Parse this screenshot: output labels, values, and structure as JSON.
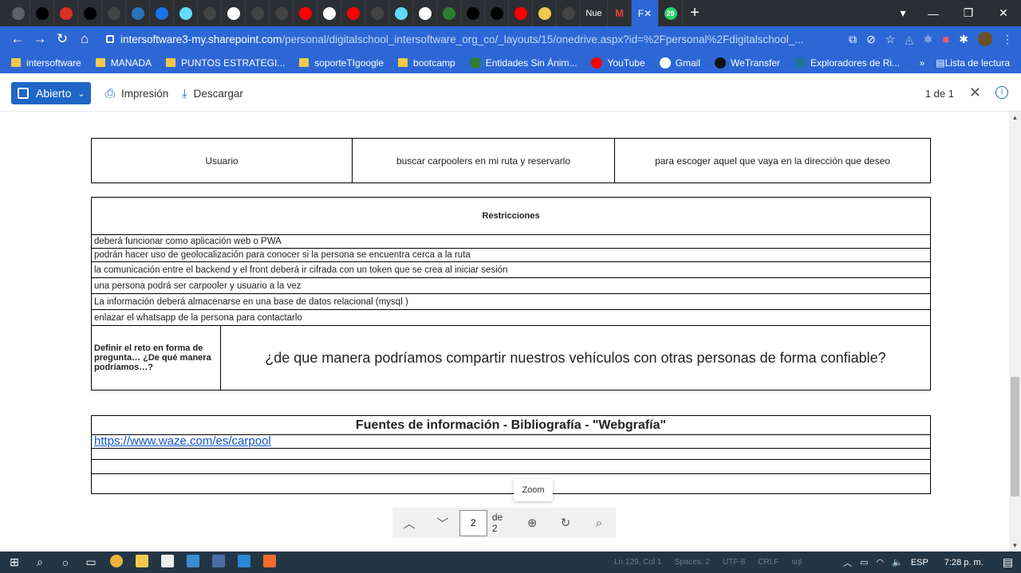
{
  "browser": {
    "tabs": [
      {
        "icon": "chrome-icon",
        "color": "#5f6368"
      },
      {
        "icon": "bowtie-icon",
        "color": "#000000"
      },
      {
        "icon": "red-hex-icon",
        "color": "#d93025"
      },
      {
        "icon": "bowtie-icon",
        "color": "#000000"
      },
      {
        "icon": "github-icon",
        "color": "#444444"
      },
      {
        "icon": "js-icon",
        "color": "#2a73b8"
      },
      {
        "icon": "sync-icon",
        "color": "#1a73e8"
      },
      {
        "icon": "react-icon",
        "color": "#61dafb"
      },
      {
        "icon": "github-icon",
        "color": "#444444"
      },
      {
        "icon": "google-icon",
        "color": "#ffffff"
      },
      {
        "icon": "github-icon",
        "color": "#444444"
      },
      {
        "icon": "github-icon",
        "color": "#444444"
      },
      {
        "icon": "youtube-icon",
        "color": "#ff0000"
      },
      {
        "icon": "play-icon",
        "color": "#ffffff"
      },
      {
        "icon": "youtube-icon",
        "color": "#ff0000"
      },
      {
        "icon": "github-icon",
        "color": "#444444"
      },
      {
        "icon": "react-icon",
        "color": "#61dafb"
      },
      {
        "icon": "google-icon",
        "color": "#ffffff"
      },
      {
        "icon": "green-circle-icon",
        "color": "#2e7d32"
      },
      {
        "icon": "medium-icon",
        "color": "#000000"
      },
      {
        "icon": "bowtie-icon",
        "color": "#000000"
      },
      {
        "icon": "youtube-icon",
        "color": "#ff0000"
      },
      {
        "icon": "braces-icon",
        "color": "#f2c94c"
      },
      {
        "icon": "github-icon",
        "color": "#444444"
      }
    ],
    "tab_text": "Nue",
    "gmail_tab": "M",
    "active_tab": "F",
    "whatsapp_badge": "29",
    "url_host": "intersoftware3-my.sharepoint.com",
    "url_path": "/personal/digitalschool_intersoftware_org_co/_layouts/15/onedrive.aspx?id=%2Fpersonal%2Fdigitalschool_..."
  },
  "bookmarks": {
    "items": [
      {
        "label": "intersoftware",
        "type": "folder"
      },
      {
        "label": "MANADA",
        "type": "folder"
      },
      {
        "label": "PUNTOS ESTRATEGI...",
        "type": "folder"
      },
      {
        "label": "soporteTIgoogle",
        "type": "folder"
      },
      {
        "label": "bootcamp",
        "type": "folder"
      },
      {
        "label": "Entidades Sin Ánim...",
        "type": "link",
        "icon": "tree-icon",
        "color": "#2e7d32"
      },
      {
        "label": "YouTube",
        "type": "link",
        "icon": "youtube-icon",
        "color": "#ff0000"
      },
      {
        "label": "Gmail",
        "type": "link",
        "icon": "google-icon",
        "color": "#ffffff"
      },
      {
        "label": "WeTransfer",
        "type": "link",
        "icon": "we-icon",
        "color": "#111111"
      },
      {
        "label": "Exploradores de Ri...",
        "type": "link",
        "icon": "wordpress-icon",
        "color": "#21759b"
      }
    ],
    "overflow": "»",
    "reading_list": "Lista de lectura"
  },
  "viewer": {
    "open_label": "Abierto",
    "print_label": "Impresión",
    "download_label": "Descargar",
    "page_count": "1 de 1"
  },
  "document": {
    "user_story": {
      "role": "Usuario",
      "action": "buscar carpoolers en mi ruta  y reservarlo",
      "purpose": "para escoger aquel que vaya en la dirección que deseo"
    },
    "restrictions": {
      "title": "Restricciones",
      "items": [
        "deberá funcionar como aplicación web o PWA",
        "podrán hacer uso de geolocalización para conocer si la persona se encuentra cerca a la ruta",
        "la comunicación entre el backend y el front deberá ir cifrada con un token que se crea al iniciar sesión",
        "una persona podrá ser carpooler y usuario a la vez",
        "La información deberá almacenarse en una base de datos relacional (mysql )",
        "enlazar el whatsapp de la persona para contactarlo"
      ],
      "challenge_label": "Definir el reto en forma de pregunta… ¿De qué manera podríamos…?",
      "challenge_question": "¿de que manera podríamos compartir nuestros vehículos con otras personas de forma confiable?"
    },
    "sources": {
      "title": "Fuentes de información - Bibliografía - \"Webgrafía\"",
      "link": "https://www.waze.com/es/carpool"
    }
  },
  "pager": {
    "tooltip": "Zoom",
    "current_page": "2",
    "total": "de 2"
  },
  "taskbar": {
    "status_line": "Ln 129, Col 1",
    "spaces": "Spaces: 2",
    "encoding": "UTF-8",
    "eol": "CRLF",
    "language": "sql",
    "lang_indicator": "ESP",
    "time": "7:28 p. m."
  }
}
